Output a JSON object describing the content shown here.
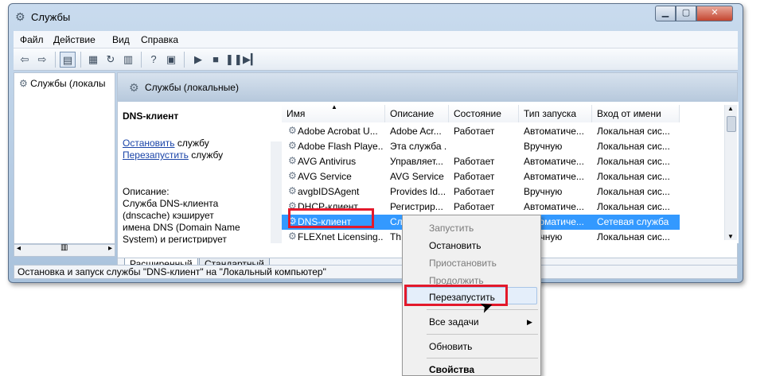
{
  "window": {
    "title": "Службы"
  },
  "menubar": {
    "items": [
      "Файл",
      "Действие",
      "Вид",
      "Справка"
    ]
  },
  "tree": {
    "item": "Службы (локалы"
  },
  "right_header": {
    "title": "Службы (локальные)"
  },
  "description": {
    "service_name": "DNS-клиент",
    "start_link": "Остановить",
    "start_suffix": " службу",
    "restart_link": "Перезапустить",
    "restart_suffix": " службу",
    "text": "Описание:\nСлужба DNS-клиента (dnscache) кэширует имена DNS (Domain Name System) и регистрирует полное имя данного"
  },
  "list": {
    "columns": [
      "Имя",
      "Описание",
      "Состояние",
      "Тип запуска",
      "Вход от имени"
    ],
    "rows": [
      [
        "Adobe Acrobat U...",
        "Adobe Acr...",
        "Работает",
        "Автоматиче...",
        "Локальная сис..."
      ],
      [
        "Adobe Flash Playe...",
        "Эта служба ...",
        "",
        "Вручную",
        "Локальная сис..."
      ],
      [
        "AVG Antivirus",
        "Управляет...",
        "Работает",
        "Автоматиче...",
        "Локальная сис..."
      ],
      [
        "AVG Service",
        "AVG Service",
        "Работает",
        "Автоматиче...",
        "Локальная сис..."
      ],
      [
        "avgbIDSAgent",
        "Provides Id...",
        "Работает",
        "Вручную",
        "Локальная сис..."
      ],
      [
        "DHCP-клиент",
        "Регистрир...",
        "Работает",
        "Автоматиче...",
        "Локальная сис..."
      ],
      [
        "DNS-клиент",
        "Служба D...",
        "Работает",
        "Автоматиче...",
        "Сетевая служба"
      ],
      [
        "FLEXnet Licensing...",
        "Th...",
        "",
        "Вручную",
        "Локальная сис..."
      ]
    ],
    "selected_index": 6
  },
  "tabs": [
    "Расширенный",
    "Стандартный"
  ],
  "statusbar": {
    "text": "Остановка и запуск службы \"DNS-клиент\" на \"Локальный компьютер\""
  },
  "context_menu": {
    "items": [
      {
        "label": "Запустить",
        "state": "disabled"
      },
      {
        "label": "Остановить",
        "state": "enabled"
      },
      {
        "label": "Приостановить",
        "state": "disabled"
      },
      {
        "label": "Продолжить",
        "state": "disabled"
      },
      {
        "label": "Перезапустить",
        "state": "highlighted"
      },
      {
        "label": "Все задачи",
        "state": "submenu"
      },
      {
        "label": "Обновить",
        "state": "enabled"
      },
      {
        "label": "Свойства",
        "state": "bold"
      }
    ]
  },
  "colors": {
    "highlight_red": "#e3192b",
    "selection": "#3399ff",
    "link": "#1a44a8"
  },
  "icons": [
    "gear-icon",
    "back-arrow-icon",
    "forward-arrow-icon",
    "play-icon",
    "stop-icon",
    "pause-icon",
    "restart-icon"
  ]
}
